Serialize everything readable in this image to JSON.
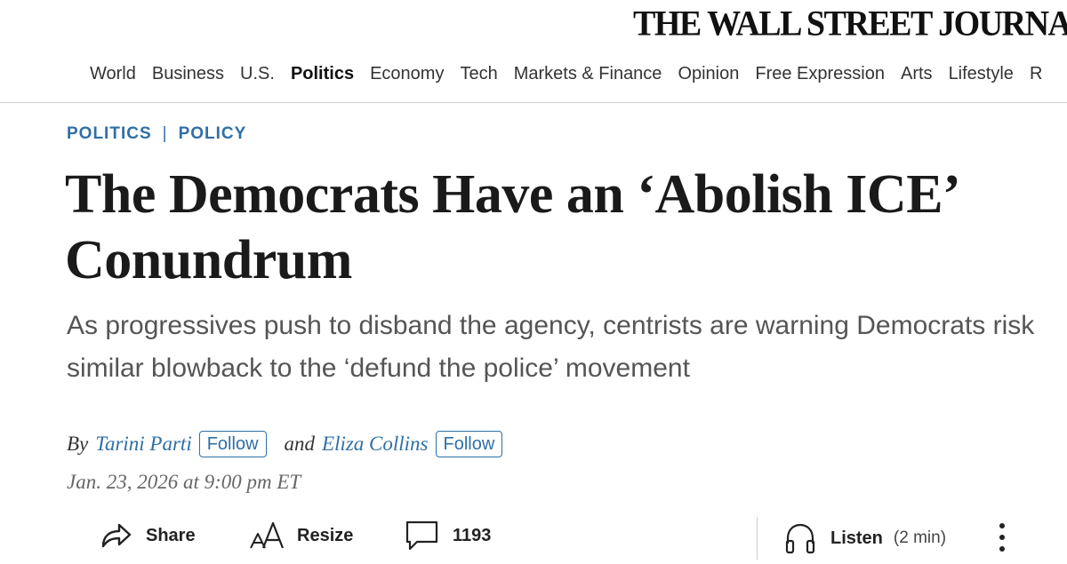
{
  "masthead": "THE WALL STREET JOURNAL.",
  "nav": {
    "items": [
      "World",
      "Business",
      "U.S.",
      "Politics",
      "Economy",
      "Tech",
      "Markets & Finance",
      "Opinion",
      "Free Expression",
      "Arts",
      "Lifestyle",
      "R"
    ],
    "active": "Politics"
  },
  "kicker": {
    "section": "POLITICS",
    "separator": "|",
    "subsection": "POLICY"
  },
  "headline": "The Democrats Have an ‘Abolish ICE’ Conundrum",
  "dek": "As progressives push to disband the agency, centrists are warning Democrats risk similar blowback to the ‘defund the police’ movement",
  "byline": {
    "by": "By",
    "author1": "Tarini Parti",
    "and": "and",
    "author2": "Eliza Collins",
    "follow_label": "Follow"
  },
  "dateline": "Jan. 23, 2026 at 9:00 pm ET",
  "toolbar": {
    "share_label": "Share",
    "resize_label": "Resize",
    "comment_count": "1193",
    "listen_label": "Listen",
    "listen_duration": "(2 min)"
  },
  "colors": {
    "accent": "#2f6fa6",
    "text": "#1a1a1a",
    "dek": "#555555"
  },
  "icons": {
    "share": "share-arrow-icon",
    "resize": "text-resize-icon",
    "comments": "comment-bubble-icon",
    "listen": "headphones-icon",
    "more": "more-vertical-icon"
  }
}
